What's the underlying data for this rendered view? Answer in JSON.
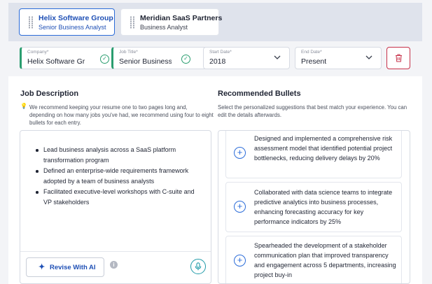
{
  "tabs": [
    {
      "company": "Helix Software Group",
      "role": "Senior Business Analyst",
      "active": true
    },
    {
      "company": "Meridian SaaS Partners",
      "role": "Business Analyst",
      "active": false
    }
  ],
  "form": {
    "company": {
      "label": "Company*",
      "value": "Helix Software Gr"
    },
    "job_title": {
      "label": "Job Title*",
      "value": "Senior Business A"
    },
    "start_date": {
      "label": "Start Date*",
      "value": "2018"
    },
    "end_date": {
      "label": "End Date*",
      "value": "Present"
    }
  },
  "job_description": {
    "heading": "Job Description",
    "tip": "We recommend keeping your resume one to two pages long and, depending on how many jobs you've had, we recommend using four to eight bullets for each entry.",
    "bullets": [
      "Lead business analysis across a SaaS platform transformation program",
      "Defined an enterprise-wide requirements framework adopted by a team of business analysts",
      "Facilitated executive-level workshops with C-suite and VP stakeholders"
    ],
    "revise_label": "Revise With AI",
    "info_glyph": "i"
  },
  "recommended": {
    "heading": "Recommended Bullets",
    "hint": "Select the personalized suggestions that best match your experience. You can edit the details afterwards.",
    "items": [
      "Designed and implemented a comprehensive risk assessment model that identified potential project bottlenecks, reducing delivery delays by 20%",
      "Collaborated with data science teams to integrate predictive analytics into business processes, enhancing forecasting accuracy for key performance indicators by 25%",
      "Spearheaded the development of a stakeholder communication plan that improved transparency and engagement across 5 departments, increasing project buy-in"
    ]
  },
  "icons": {
    "check": "check-circle-icon",
    "chevron": "chevron-down-icon",
    "trash": "trash-icon",
    "plus": "plus-circle-icon",
    "mic": "microphone-icon",
    "sparkle": "sparkle-icon",
    "info": "info-icon",
    "bulb": "lightbulb-icon"
  },
  "colors": {
    "accent": "#2b6cd9",
    "success": "#2a9d6f",
    "danger": "#c73049",
    "mic": "#1e9aa8"
  }
}
